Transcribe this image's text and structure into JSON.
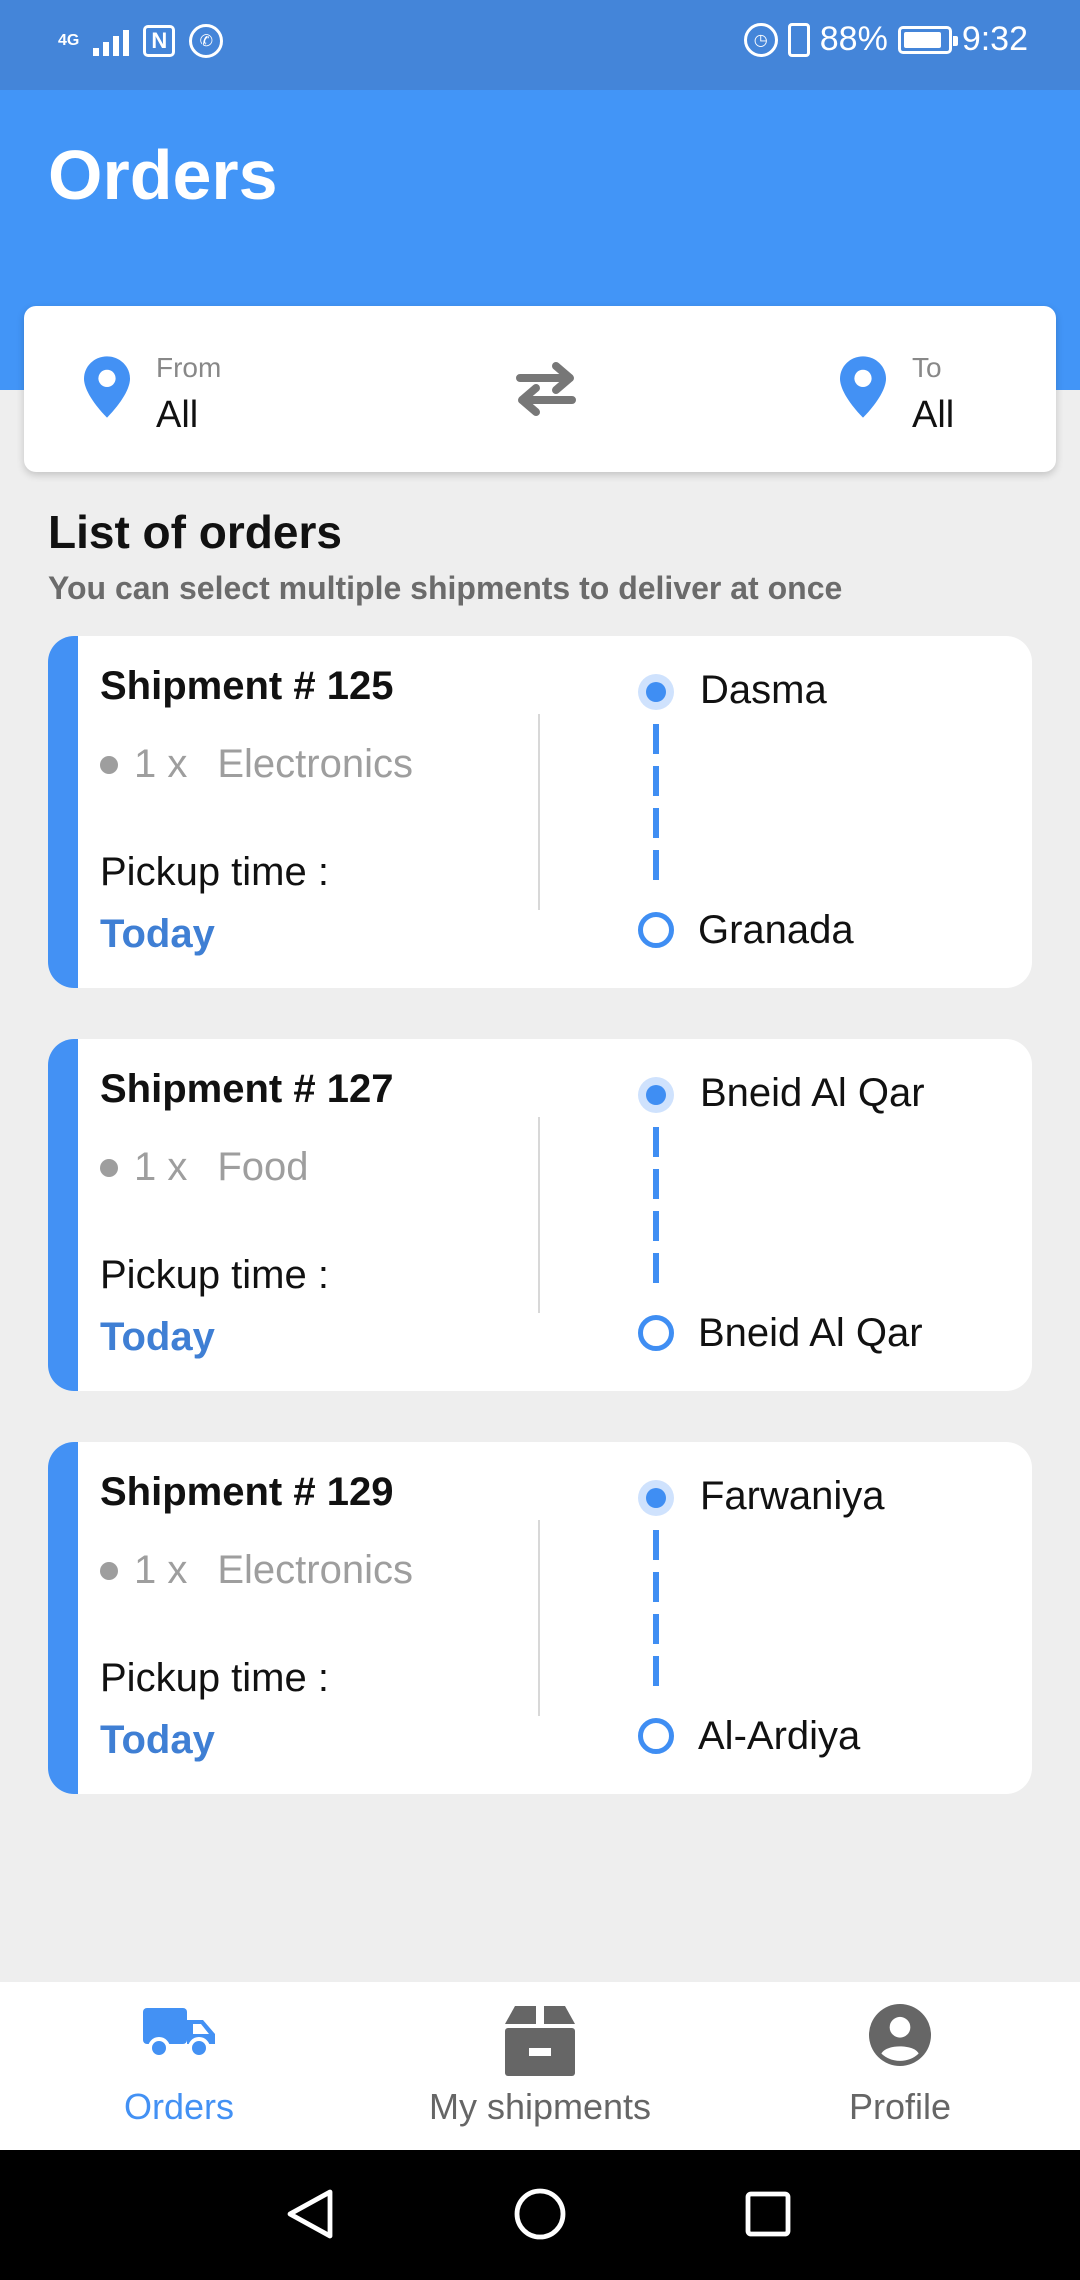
{
  "status_bar": {
    "network": "4G",
    "battery": "88%",
    "battery_level": 0.88,
    "time": "9:32",
    "icons": [
      "signal-icon",
      "nfc-icon",
      "whatsapp-icon",
      "alarm-icon",
      "vibrate-icon",
      "battery-icon"
    ]
  },
  "header": {
    "title": "Orders"
  },
  "route": {
    "from_label": "From",
    "from_value": "All",
    "to_label": "To",
    "to_value": "All"
  },
  "list": {
    "title": "List of orders",
    "subtitle": "You can select multiple shipments to deliver at once"
  },
  "orders": [
    {
      "title": "Shipment # 125",
      "qty": "1 x",
      "item": "Electronics",
      "pickup_label": "Pickup time :",
      "pickup_value": "Today",
      "from": "Dasma",
      "to": "Granada"
    },
    {
      "title": "Shipment # 127",
      "qty": "1 x",
      "item": "Food",
      "pickup_label": "Pickup time :",
      "pickup_value": "Today",
      "from": "Bneid Al Qar",
      "to": "Bneid Al Qar"
    },
    {
      "title": "Shipment # 129",
      "qty": "1 x",
      "item": "Electronics",
      "pickup_label": "Pickup time :",
      "pickup_value": "Today",
      "from": "Farwaniya",
      "to": "Al-Ardiya"
    }
  ],
  "bottom_nav": {
    "tabs": [
      {
        "label": "Orders",
        "icon": "truck-icon",
        "active": true
      },
      {
        "label": "My shipments",
        "icon": "box-icon",
        "active": false
      },
      {
        "label": "Profile",
        "icon": "account-icon",
        "active": false
      }
    ]
  },
  "system_nav": {
    "icons": [
      "back-icon",
      "home-icon",
      "recents-icon"
    ]
  },
  "colors": {
    "status_bar": "#4485d9",
    "header": "#4295f7",
    "accent": "#4391f4",
    "pickup_value": "#3f7fd4",
    "active_tab": "#4391f4",
    "inactive_tab": "#666666",
    "background": "#eeeeee"
  }
}
